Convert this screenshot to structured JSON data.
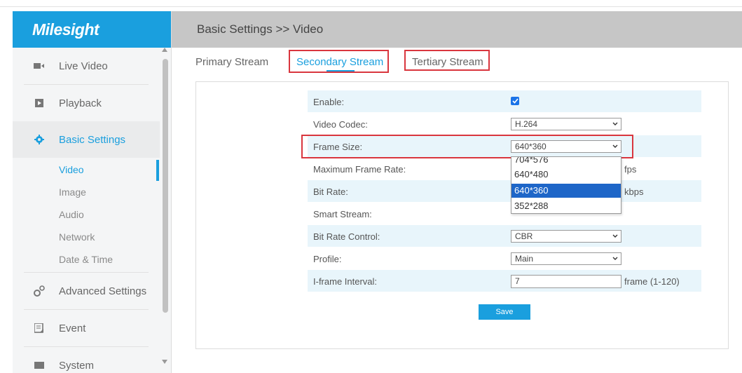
{
  "brand": {
    "name": "Milesight"
  },
  "header": {
    "breadcrumb": "Basic Settings >> Video"
  },
  "sidebar": {
    "items": [
      {
        "label": "Live Video",
        "icon": "video-camera-icon"
      },
      {
        "label": "Playback",
        "icon": "play-icon"
      },
      {
        "label": "Basic Settings",
        "icon": "gear-icon"
      },
      {
        "label": "Advanced Settings",
        "icon": "gears-icon"
      },
      {
        "label": "Event",
        "icon": "event-icon"
      },
      {
        "label": "System",
        "icon": "system-icon"
      }
    ],
    "sub_items": [
      "Video",
      "Image",
      "Audio",
      "Network",
      "Date & Time"
    ]
  },
  "tabs": [
    "Primary Stream",
    "Secondary Stream",
    "Tertiary Stream"
  ],
  "form": {
    "enable_label": "Enable:",
    "enable_checked": true,
    "video_codec_label": "Video Codec:",
    "video_codec_value": "H.264",
    "frame_size_label": "Frame Size:",
    "frame_size_value": "640*360",
    "max_frame_rate_label": "Maximum Frame Rate:",
    "max_frame_rate_unit": "fps",
    "bit_rate_label": "Bit Rate:",
    "bit_rate_unit": "kbps",
    "smart_stream_label": "Smart Stream:",
    "bit_rate_control_label": "Bit Rate Control:",
    "bit_rate_control_value": "CBR",
    "profile_label": "Profile:",
    "profile_value": "Main",
    "iframe_label": "I-frame Interval:",
    "iframe_value": "7",
    "iframe_unit": "frame (1-120)"
  },
  "frame_size_options": [
    "704*576",
    "640*480",
    "640*360",
    "352*288"
  ],
  "save_label": "Save",
  "colors": {
    "accent": "#1a9fde",
    "highlight": "#d9363e",
    "selected_option": "#1e66c8"
  }
}
